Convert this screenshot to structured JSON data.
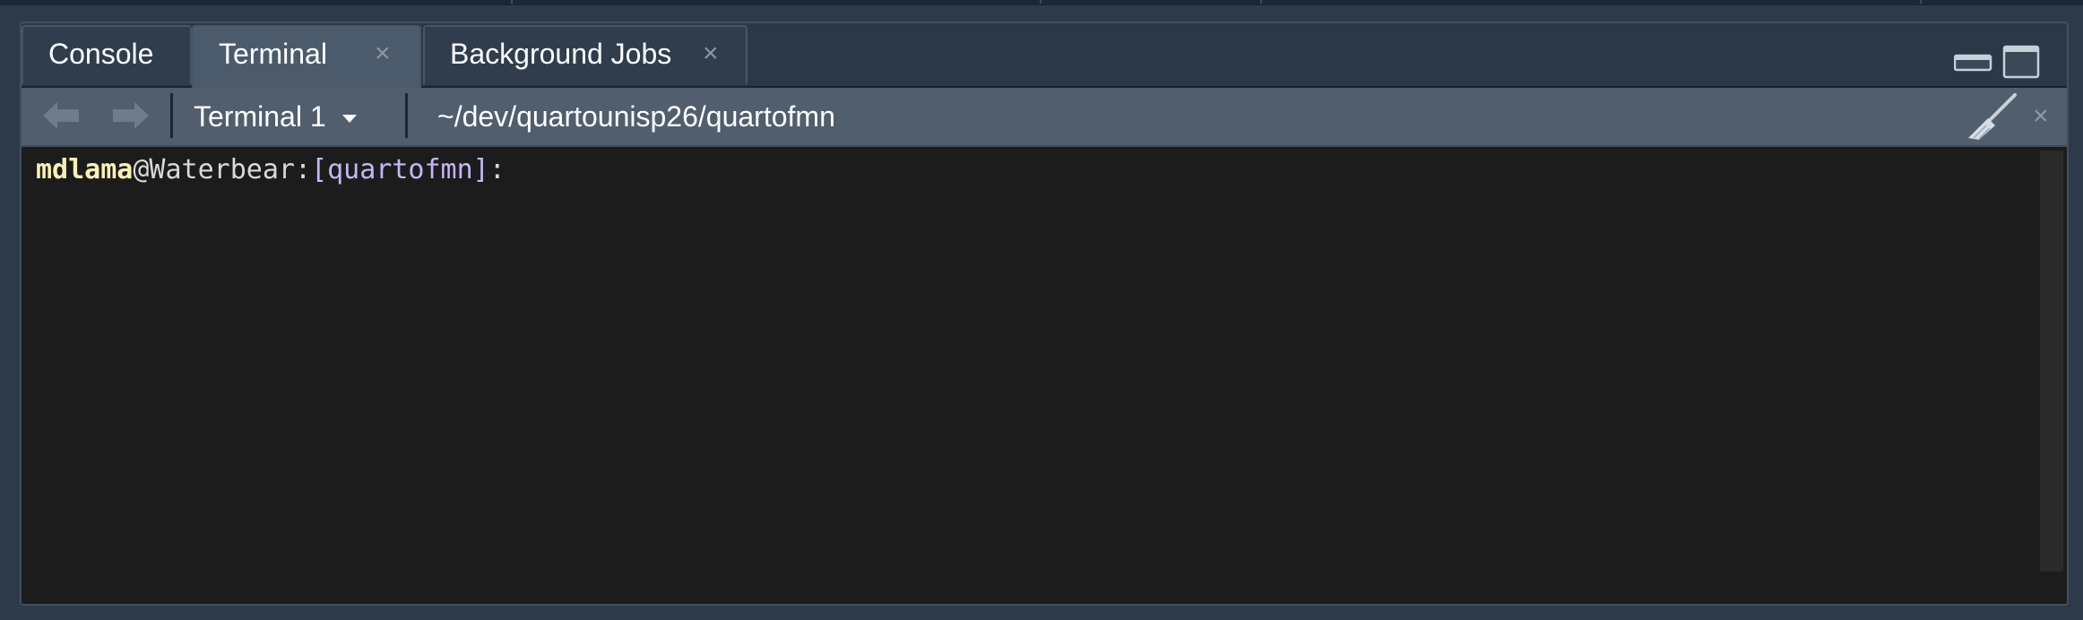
{
  "tabs": [
    {
      "label": "Console",
      "active": false,
      "closable": false
    },
    {
      "label": "Terminal",
      "active": true,
      "closable": true
    },
    {
      "label": "Background Jobs",
      "active": false,
      "closable": true
    }
  ],
  "tab_close_glyph": "×",
  "toolbar": {
    "terminal_selector": "Terminal 1",
    "path": "~/dev/quartounisp26/quartofmn",
    "close_glyph": "×",
    "icons": [
      "back-arrow-icon",
      "forward-arrow-icon",
      "dropdown-caret-icon",
      "broom-icon",
      "close-icon"
    ]
  },
  "pane_controls": [
    "minimize-icon",
    "maximize-icon"
  ],
  "terminal": {
    "prompt_user": "mdlama",
    "prompt_host": "@Waterbear:",
    "prompt_dir": "[quartofmn]",
    "prompt_suffix": ":"
  },
  "colors": {
    "prompt_user": "#f9f0b4",
    "prompt_dir": "#c6b6f7",
    "terminal_bg": "#1c1c1c",
    "tab_active": "#4c5b6b",
    "toolbar": "#505e6d"
  }
}
